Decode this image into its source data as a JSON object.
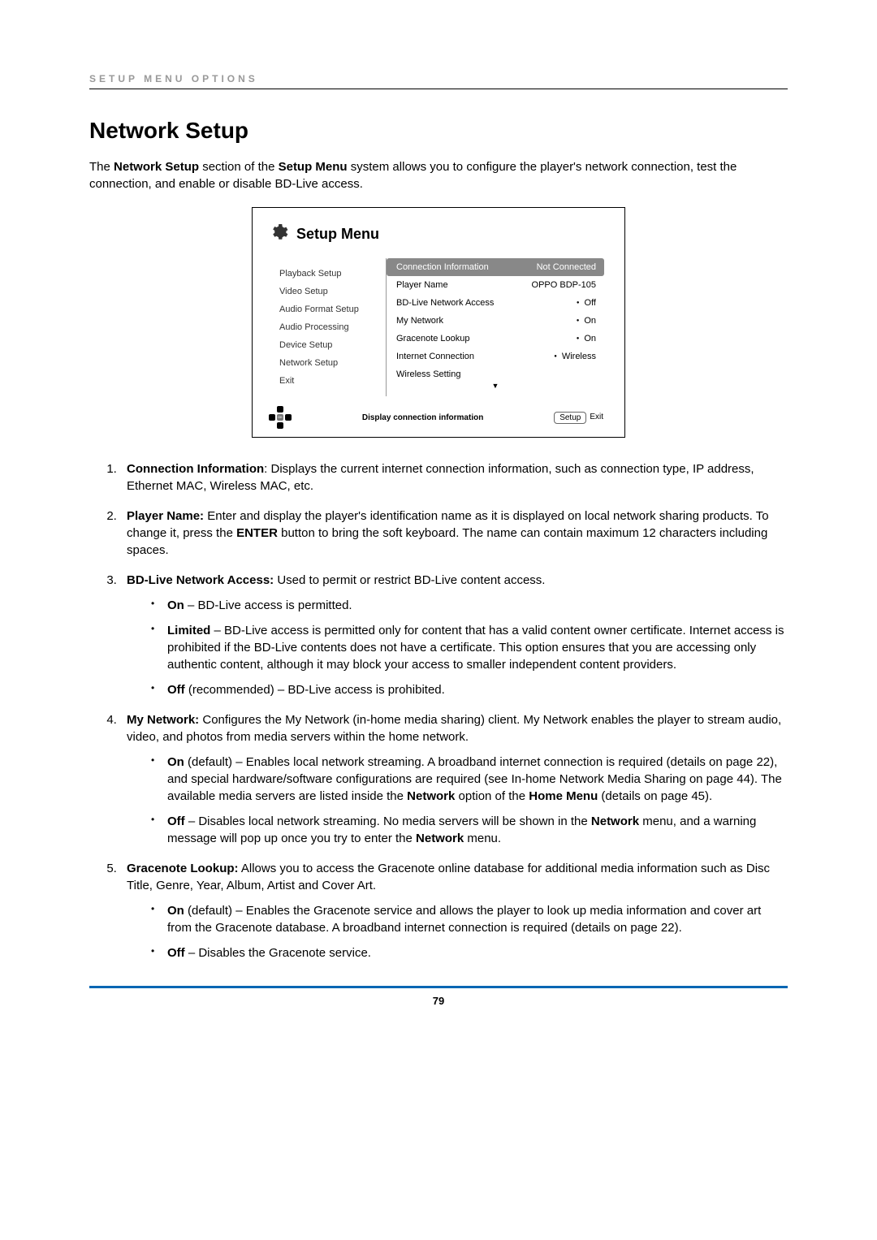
{
  "header": {
    "section_label": "SETUP MENU OPTIONS"
  },
  "title": "Network Setup",
  "intro": {
    "p1a": "The ",
    "p1b": "Network Setup",
    "p1c": " section of the ",
    "p1d": "Setup Menu",
    "p1e": " system allows you to configure the player's network connection, test the connection, and enable or disable BD-Live access."
  },
  "screenshot": {
    "title": "Setup Menu",
    "left": {
      "i0": "Playback Setup",
      "i1": "Video Setup",
      "i2": "Audio Format Setup",
      "i3": "Audio Processing",
      "i4": "Device Setup",
      "i5": "Network Setup",
      "i6": "Exit"
    },
    "right": {
      "r0l": "Connection Information",
      "r0v": "Not Connected",
      "r1l": "Player Name",
      "r1v": "OPPO BDP-105",
      "r2l": "BD-Live Network Access",
      "r2v": "Off",
      "r3l": "My Network",
      "r3v": "On",
      "r4l": "Gracenote Lookup",
      "r4v": "On",
      "r5l": "Internet Connection",
      "r5v": "Wireless",
      "r6l": "Wireless Setting",
      "r6v": ""
    },
    "help": "Display connection information",
    "btn_setup": "Setup",
    "btn_exit": "Exit"
  },
  "items": {
    "i1": {
      "b": "Connection Information",
      "t": ": Displays the current internet connection information, such as connection type, IP address, Ethernet MAC, Wireless MAC, etc."
    },
    "i2": {
      "b": "Player Name:",
      "t1": " Enter and display the player's identification name as it is displayed on local network sharing products. To change it, press the ",
      "b2": "ENTER",
      "t2": " button to bring the soft keyboard. The name can contain maximum 12 characters including spaces."
    },
    "i3": {
      "b": "BD-Live Network Access:",
      "t": " Used to permit or restrict BD-Live content access.",
      "s1b": "On",
      "s1t": " – BD-Live access is permitted.",
      "s2b": "Limited",
      "s2t": " – BD-Live access is permitted only for content that has a valid content owner certificate. Internet access is prohibited if the BD-Live contents does not have a certificate. This option ensures that you are accessing only authentic content, although it may block your access to smaller independent content providers.",
      "s3b": "Off",
      "s3t": " (recommended) – BD-Live access is prohibited."
    },
    "i4": {
      "b": "My Network:",
      "t": " Configures the My Network (in-home media sharing) client. My Network enables the player to stream audio, video, and photos from media servers within the home network.",
      "s1b": "On",
      "s1t1": " (default) – Enables local network streaming. A broadband internet connection is required (details on page 22), and special hardware/software configurations are required (see In-home Network Media Sharing on page 44). The available media servers are listed inside the ",
      "s1b2": "Network",
      "s1t2": " option of the ",
      "s1b3": "Home Menu",
      "s1t3": " (details on page 45).",
      "s2b": "Off",
      "s2t1": " – Disables local network streaming. No media servers will be shown in the ",
      "s2b2": "Network",
      "s2t2": " menu, and a warning message will pop up once you try to enter the ",
      "s2b3": "Network",
      "s2t3": " menu."
    },
    "i5": {
      "b": "Gracenote Lookup:",
      "t": " Allows you to access the Gracenote online database for additional media information such as Disc Title, Genre, Year, Album, Artist and Cover Art.",
      "s1b": "On",
      "s1t": " (default) – Enables the Gracenote service and allows the player to look up media information and cover art from the Gracenote database. A broadband internet connection is required (details on page 22).",
      "s2b": "Off",
      "s2t": " – Disables the Gracenote service."
    }
  },
  "page_number": "79"
}
